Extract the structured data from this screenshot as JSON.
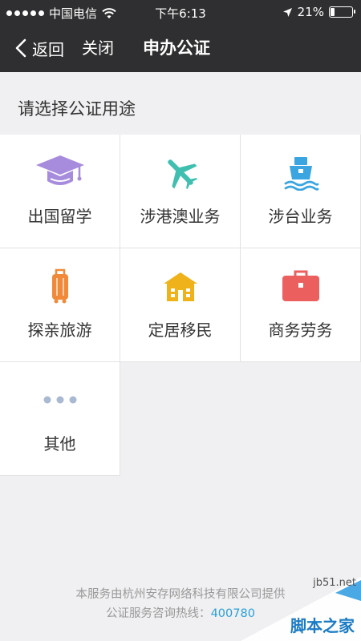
{
  "status_bar": {
    "carrier": "中国电信",
    "time": "下午6:13",
    "battery": "21%",
    "battery_level": 0.21
  },
  "nav": {
    "back_label": "返回",
    "close_label": "关闭",
    "title": "申办公证"
  },
  "section": {
    "title": "请选择公证用途"
  },
  "purposes": [
    {
      "label": "出国留学",
      "icon": "graduation-cap-icon",
      "color": "#a78bdc"
    },
    {
      "label": "涉港澳业务",
      "icon": "airplane-icon",
      "color": "#3fbfb0"
    },
    {
      "label": "涉台业务",
      "icon": "ship-icon",
      "color": "#3aa5e0"
    },
    {
      "label": "探亲旅游",
      "icon": "luggage-icon",
      "color": "#f08a3a"
    },
    {
      "label": "定居移民",
      "icon": "house-icon",
      "color": "#f0b21a"
    },
    {
      "label": "商务劳务",
      "icon": "briefcase-icon",
      "color": "#ec5f5f"
    },
    {
      "label": "其他",
      "icon": "more-dots-icon",
      "color": "#a9b9d2"
    }
  ],
  "footer": {
    "provider": "本服务由杭州安存网络科技有限公司提供",
    "hotline_label": "公证服务咨询热线：",
    "hotline_number": "400780"
  },
  "watermark": {
    "url": "jb51.net",
    "name": "脚本之家"
  }
}
